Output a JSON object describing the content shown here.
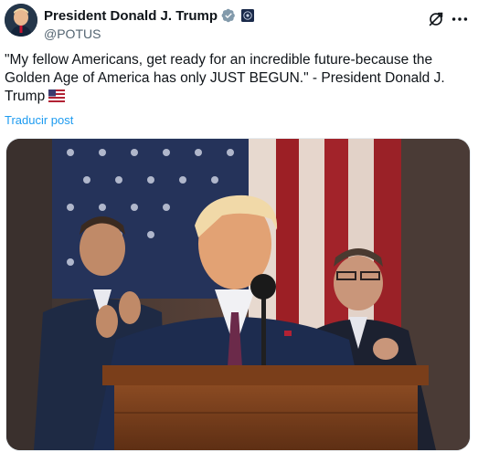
{
  "post": {
    "author": {
      "display_name": "President Donald J. Trump",
      "handle": "@POTUS",
      "verified": true,
      "affiliation_badge": "us-government-seal",
      "avatar_icon": "profile-photo"
    },
    "text": "\"My fellow Americans, get ready for an incredible future-because the Golden Age of America has only JUST BEGUN.\" - President Donald J. Trump",
    "text_emoji": "us-flag-emoji",
    "translate_label": "Traducir post",
    "actions": {
      "grok_icon": "grok-icon",
      "more_icon": "more-options-icon"
    },
    "media": {
      "type": "photo"
    }
  },
  "colors": {
    "text": "#0f1419",
    "secondary": "#536471",
    "link": "#1d9bf0",
    "verified": "#829aab"
  }
}
